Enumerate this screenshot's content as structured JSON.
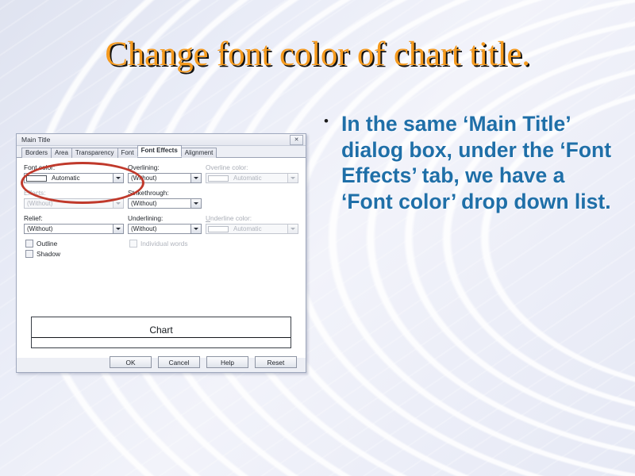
{
  "slide": {
    "title": "Change font color of chart title.",
    "title_color": "#F59A1E",
    "title_shadow_color": "#111111",
    "background_color": "#e9ecf7"
  },
  "body": {
    "bullet_marker": "•",
    "bullet_text": "In the same ‘Main Title’ dialog box, under the ‘Font Effects’ tab, we have a ‘Font color’ drop down list.",
    "text_color": "#1F6FA8"
  },
  "dialog": {
    "title": "Main Title",
    "close_glyph": "✕",
    "tabs": [
      {
        "label": "Borders",
        "active": false
      },
      {
        "label": "Area",
        "active": false
      },
      {
        "label": "Transparency",
        "active": false
      },
      {
        "label": "Font",
        "active": false
      },
      {
        "label": "Font Effects",
        "active": true
      },
      {
        "label": "Alignment",
        "active": false
      }
    ],
    "fields": {
      "font_color_label": "Font color:",
      "font_color_value": "Automatic",
      "effects_label": "Effects:",
      "effects_value": "(Without)",
      "relief_label": "Relief:",
      "relief_value": "(Without)",
      "overlining_label": "Overlining:",
      "overlining_value": "(Without)",
      "overline_color_label": "Overline color:",
      "overline_color_value": "Automatic",
      "strikethrough_label": "Strikethrough:",
      "strikethrough_value": "(Without)",
      "underlining_label": "Underlining:",
      "underlining_value": "(Without)",
      "underline_color_label": "Underline color:",
      "underline_color_value": "Automatic"
    },
    "checkboxes": {
      "outline_label": "Outline",
      "shadow_label": "Shadow",
      "individual_words_label": "Individual words"
    },
    "preview": {
      "text": "Chart"
    },
    "buttons": {
      "ok": "OK",
      "cancel": "Cancel",
      "help": "Help",
      "reset": "Reset"
    }
  },
  "annotation": {
    "highlight_color": "#C0392B"
  }
}
